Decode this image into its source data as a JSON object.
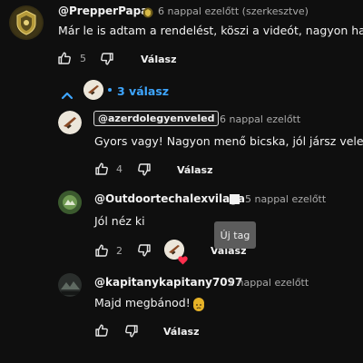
{
  "comments": {
    "main": {
      "author": "@PrepperPapa",
      "meta": "6 nappal ezelőtt (szerkesztve)",
      "text": "Már le is adtam a rendelést, köszi a videót, nagyon has",
      "likes": "5",
      "reply_label": "Válasz"
    },
    "replies_toggle": {
      "count_label": "3 válasz"
    },
    "reply1": {
      "author": "@azerdolegyenveled",
      "meta": "6 nappal ezelőtt",
      "text": "Gyors vagy! Nagyon menő bicska, jól jársz vele!",
      "likes": "4",
      "reply_label": "Válasz"
    },
    "reply2": {
      "author": "@Outdoortechalexvilaga",
      "meta": "5 nappal ezelőtt",
      "text": "Jól néz ki",
      "likes": "2",
      "reply_label": "Válasz",
      "tooltip": "Új tag"
    },
    "reply3": {
      "author": "@kapitanykapitany7097",
      "meta": "2 nappal ezelőtt",
      "text": "Majd megbánod!",
      "reply_label": "Válasz"
    }
  },
  "colors": {
    "background": "#0f0f0f",
    "accent_blue": "#3ea6ff",
    "muted_text": "#aaaaaa",
    "heart": "#ff2e4d"
  },
  "icons": {
    "like": "thumb-up-icon",
    "dislike": "thumb-down-icon",
    "collapse": "chevron-up-icon",
    "badge": "membership-badge-icon",
    "heart": "creator-heart-icon",
    "emoji": "worried-face-emoji"
  }
}
